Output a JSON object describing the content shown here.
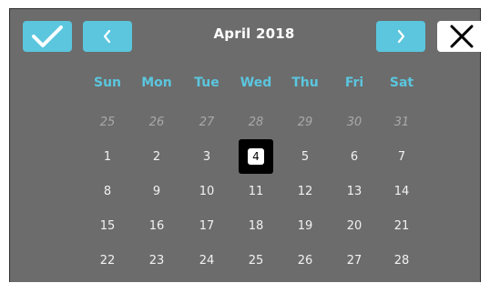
{
  "header": {
    "month_title": "April 2018",
    "ok_icon": "check-icon",
    "prev_icon": "chevron-left-icon",
    "next_icon": "chevron-right-icon",
    "close_icon": "close-icon"
  },
  "colors": {
    "panel": "#6c6c6c",
    "accent": "#5bc6de",
    "weekday_text": "#5bc6de",
    "day_text": "#f2f2f2",
    "other_month_text": "#a9a9a9",
    "selected_bg": "#000000"
  },
  "weekdays": [
    "Sun",
    "Mon",
    "Tue",
    "Wed",
    "Thu",
    "Fri",
    "Sat"
  ],
  "weeks": [
    [
      {
        "d": "25",
        "other": true
      },
      {
        "d": "26",
        "other": true
      },
      {
        "d": "27",
        "other": true
      },
      {
        "d": "28",
        "other": true
      },
      {
        "d": "29",
        "other": true
      },
      {
        "d": "30",
        "other": true
      },
      {
        "d": "31",
        "other": true
      }
    ],
    [
      {
        "d": "1"
      },
      {
        "d": "2"
      },
      {
        "d": "3"
      },
      {
        "d": "4",
        "selected": true
      },
      {
        "d": "5"
      },
      {
        "d": "6"
      },
      {
        "d": "7"
      }
    ],
    [
      {
        "d": "8"
      },
      {
        "d": "9"
      },
      {
        "d": "10"
      },
      {
        "d": "11"
      },
      {
        "d": "12"
      },
      {
        "d": "13"
      },
      {
        "d": "14"
      }
    ],
    [
      {
        "d": "15"
      },
      {
        "d": "16"
      },
      {
        "d": "17"
      },
      {
        "d": "18"
      },
      {
        "d": "19"
      },
      {
        "d": "20"
      },
      {
        "d": "21"
      }
    ],
    [
      {
        "d": "22"
      },
      {
        "d": "23"
      },
      {
        "d": "24"
      },
      {
        "d": "25"
      },
      {
        "d": "26"
      },
      {
        "d": "27"
      },
      {
        "d": "28"
      }
    ]
  ]
}
